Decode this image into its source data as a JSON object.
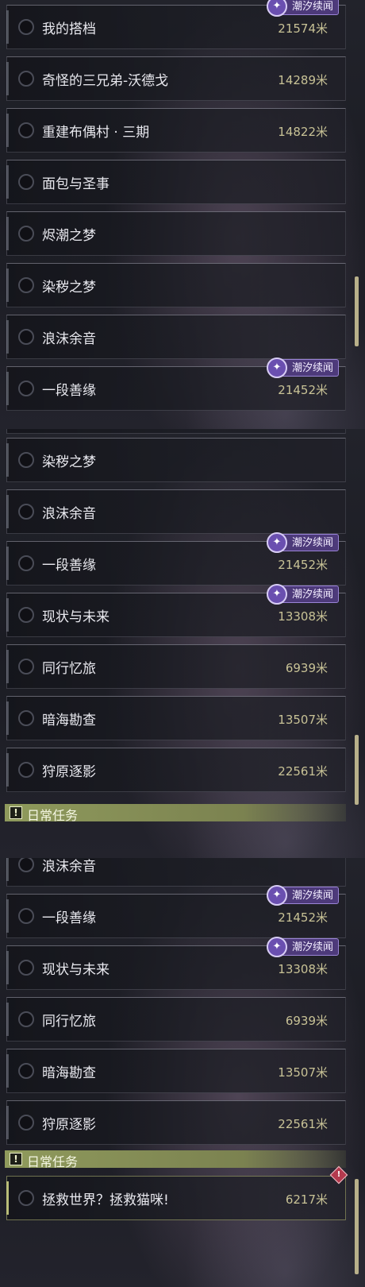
{
  "badge_label": "潮汐续闻",
  "section_title": "日常任务",
  "panel1": [
    {
      "name": "我的搭档",
      "dist": "21574米",
      "badge": true
    },
    {
      "name": "奇怪的三兄弟-沃德戈",
      "dist": "14289米",
      "badge": false
    },
    {
      "name": "重建布偶村 · 三期",
      "dist": "14822米",
      "badge": false
    },
    {
      "name": "面包与圣事",
      "dist": "",
      "badge": false
    },
    {
      "name": "烬潮之梦",
      "dist": "",
      "badge": false
    },
    {
      "name": "染秽之梦",
      "dist": "",
      "badge": false
    },
    {
      "name": "浪沫余音",
      "dist": "",
      "badge": false
    },
    {
      "name": "一段善缘",
      "dist": "21452米",
      "badge": true
    }
  ],
  "panel2": [
    {
      "name": "染秽之梦",
      "dist": "",
      "badge": false
    },
    {
      "name": "浪沫余音",
      "dist": "",
      "badge": false
    },
    {
      "name": "一段善缘",
      "dist": "21452米",
      "badge": true
    },
    {
      "name": "现状与未来",
      "dist": "13308米",
      "badge": true
    },
    {
      "name": "同行忆旅",
      "dist": "6939米",
      "badge": false
    },
    {
      "name": "暗海勘查",
      "dist": "13507米",
      "badge": false
    },
    {
      "name": "狩原逐影",
      "dist": "22561米",
      "badge": false
    }
  ],
  "panel3": [
    {
      "name": "浪沫余音",
      "dist": "",
      "badge": false
    },
    {
      "name": "一段善缘",
      "dist": "21452米",
      "badge": true
    },
    {
      "name": "现状与未来",
      "dist": "13308米",
      "badge": true
    },
    {
      "name": "同行忆旅",
      "dist": "6939米",
      "badge": false
    },
    {
      "name": "暗海勘查",
      "dist": "13507米",
      "badge": false
    },
    {
      "name": "狩原逐影",
      "dist": "22561米",
      "badge": false
    }
  ],
  "daily": {
    "name": "拯救世界？拯救猫咪!",
    "dist": "6217米"
  }
}
